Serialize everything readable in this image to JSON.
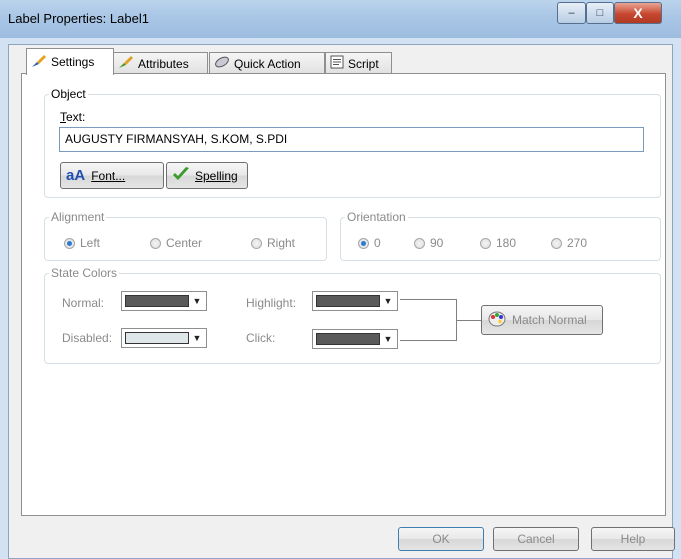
{
  "window": {
    "title": "Label Properties: Label1",
    "minimize": "–",
    "maximize": "□",
    "close": "X"
  },
  "tabs": [
    {
      "label": "Settings",
      "icon": "paintbrush-icon"
    },
    {
      "label": "Attributes",
      "icon": "brush-icon"
    },
    {
      "label": "Quick Action",
      "icon": "quick-action-icon"
    },
    {
      "label": "Script",
      "icon": "script-icon"
    }
  ],
  "object": {
    "group_label": "Object",
    "text_label": "Text:",
    "text_value": "AUGUSTY FIRMANSYAH, S.KOM, S.PDI",
    "font_button": "Font...",
    "font_icon": "aA",
    "spelling_button": "Spelling"
  },
  "alignment": {
    "group_label": "Alignment",
    "options": [
      "Left",
      "Center",
      "Right"
    ],
    "selected": "Left"
  },
  "orientation": {
    "group_label": "Orientation",
    "options": [
      "0",
      "90",
      "180",
      "270"
    ],
    "selected": "0"
  },
  "state_colors": {
    "group_label": "State Colors",
    "normal_label": "Normal:",
    "disabled_label": "Disabled:",
    "highlight_label": "Highlight:",
    "click_label": "Click:",
    "normal_color": "#5a5a5a",
    "disabled_color": "#dfe6ea",
    "highlight_color": "#5a5a5a",
    "click_color": "#5a5a5a",
    "match_button": "Match Normal"
  },
  "footer": {
    "ok": "OK",
    "cancel": "Cancel",
    "help": "Help"
  }
}
